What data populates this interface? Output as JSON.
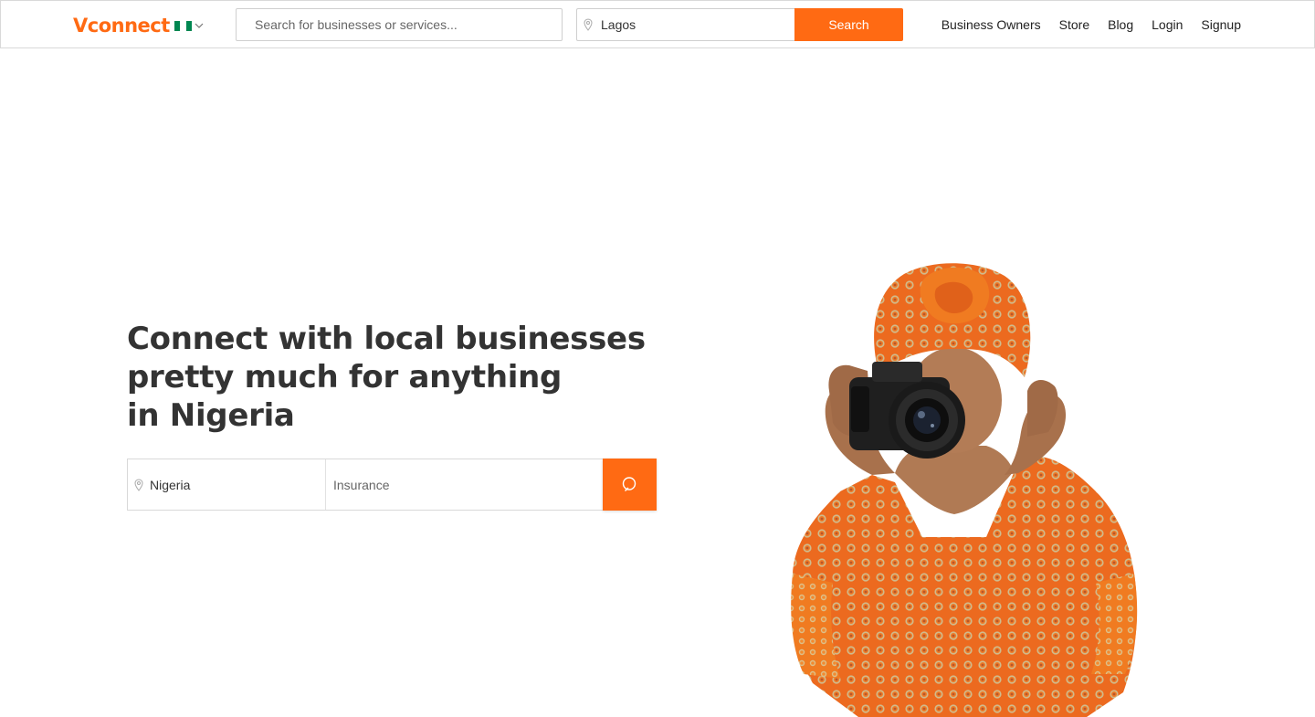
{
  "header": {
    "logo": "Vconnect",
    "search_placeholder": "Search for businesses or services...",
    "location_value": "Lagos",
    "search_button": "Search",
    "nav": [
      "Business Owners",
      "Store",
      "Blog",
      "Login",
      "Signup"
    ]
  },
  "hero": {
    "title_lines": [
      "Connect with local businesses",
      "pretty much for anything",
      "in Nigeria"
    ],
    "location_value": "Nigeria",
    "query_placeholder": "Insurance"
  },
  "colors": {
    "accent": "#ff6a13",
    "flag_green": "#008751",
    "text": "#333333"
  },
  "icons": [
    "nigeria-flag-icon",
    "chevron-down-icon",
    "location-pin-icon",
    "search-icon"
  ]
}
